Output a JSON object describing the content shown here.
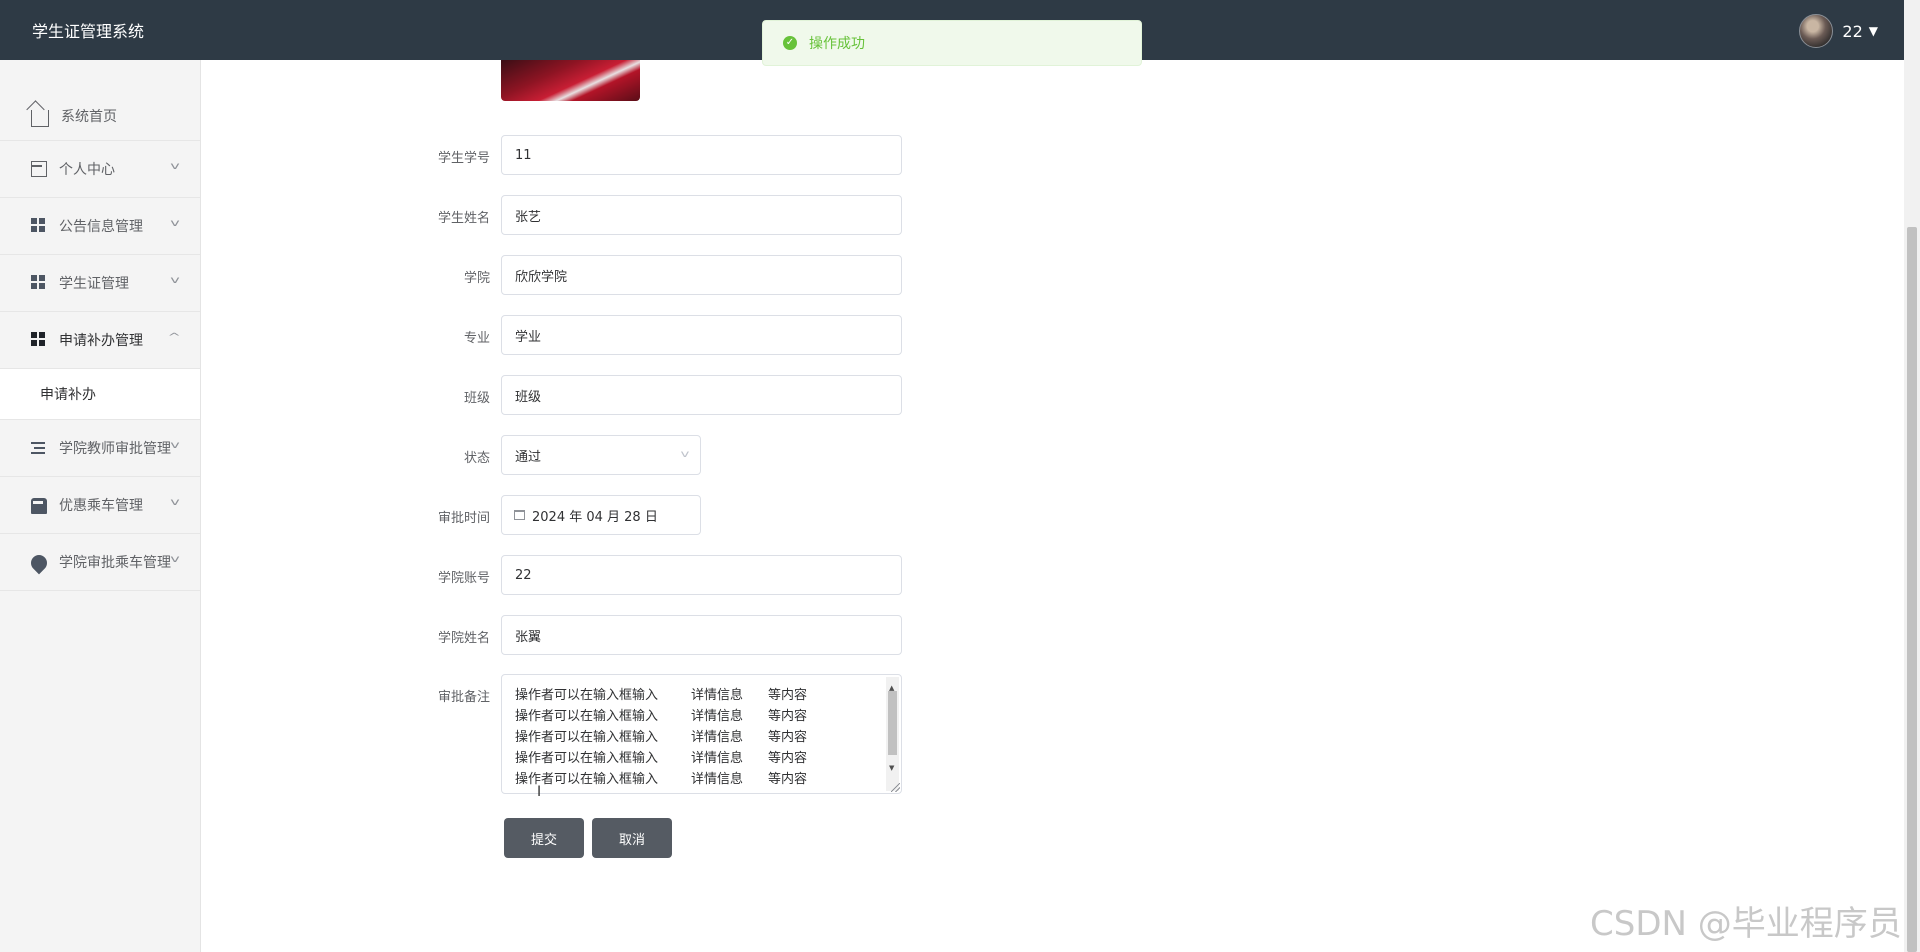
{
  "app": {
    "title": "学生证管理系统"
  },
  "user": {
    "name": "22"
  },
  "toast": {
    "message": "操作成功",
    "color": "#67c23a"
  },
  "sidebar": {
    "items": [
      {
        "label": "系统首页",
        "icon": "home-icon"
      },
      {
        "label": "个人中心",
        "icon": "card-icon"
      },
      {
        "label": "公告信息管理",
        "icon": "grid-icon"
      },
      {
        "label": "学生证管理",
        "icon": "grid-icon"
      },
      {
        "label": "申请补办管理",
        "icon": "grid-icon",
        "expanded": true
      },
      {
        "label": "学院教师审批管理",
        "icon": "list-icon"
      },
      {
        "label": "优惠乘车管理",
        "icon": "bus-icon"
      },
      {
        "label": "学院审批乘车管理",
        "icon": "pin-icon"
      }
    ],
    "subitems": [
      {
        "label": "申请补办"
      }
    ]
  },
  "form": {
    "student_no": {
      "label": "学生学号",
      "value": "11"
    },
    "student_name": {
      "label": "学生姓名",
      "value": "张艺"
    },
    "college": {
      "label": "学院",
      "value": "欣欣学院"
    },
    "major": {
      "label": "专业",
      "value": "学业"
    },
    "class_name": {
      "label": "班级",
      "value": "班级"
    },
    "status": {
      "label": "状态",
      "value": "通过"
    },
    "approve_time": {
      "label": "审批时间",
      "value": "2024 年 04 月 28 日"
    },
    "college_account": {
      "label": "学院账号",
      "value": "22"
    },
    "college_name": {
      "label": "学院姓名",
      "value": "张翼"
    },
    "remark": {
      "label": "审批备注",
      "lines": [
        [
          "操作者可以在输入框输入",
          "详情信息",
          "等内容"
        ],
        [
          "操作者可以在输入框输入",
          "详情信息",
          "等内容"
        ],
        [
          "操作者可以在输入框输入",
          "详情信息",
          "等内容"
        ],
        [
          "操作者可以在输入框输入",
          "详情信息",
          "等内容"
        ],
        [
          "操作者可以在输入框输入",
          "详情信息",
          "等内容"
        ]
      ]
    },
    "submit_label": "提交",
    "cancel_label": "取消"
  },
  "watermark": "CSDN @毕业程序员",
  "colors": {
    "topbar": "#2e3a45",
    "button": "#555b63",
    "success": "#67c23a"
  }
}
